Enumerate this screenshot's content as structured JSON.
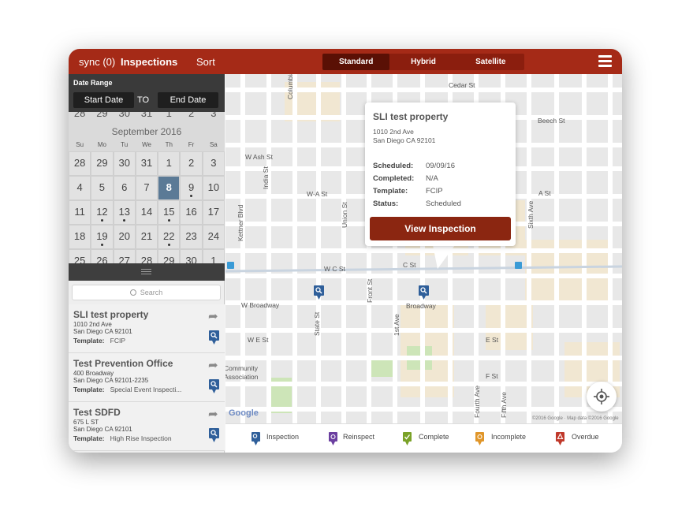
{
  "topbar": {
    "sync_label": "sync (0)",
    "inspections_label": "Inspections",
    "sort_label": "Sort",
    "map_types": [
      "Standard",
      "Hybrid",
      "Satellite"
    ],
    "active_map_type": "Standard"
  },
  "date_range": {
    "title": "Date Range",
    "start_label": "Start Date",
    "to_label": "TO",
    "end_label": "End Date"
  },
  "calendar": {
    "month_label": "September 2016",
    "prev_week_partial": [
      "28",
      "29",
      "30",
      "31",
      "1",
      "2",
      "3"
    ],
    "weekdays": [
      "Su",
      "Mo",
      "Tu",
      "We",
      "Th",
      "Fr",
      "Sa"
    ],
    "weeks": [
      [
        "28",
        "29",
        "30",
        "31",
        "1",
        "2",
        "3"
      ],
      [
        "4",
        "5",
        "6",
        "7",
        "8",
        "9",
        "10"
      ],
      [
        "11",
        "12",
        "13",
        "14",
        "15",
        "16",
        "17"
      ],
      [
        "18",
        "19",
        "20",
        "21",
        "22",
        "23",
        "24"
      ],
      [
        "25",
        "26",
        "27",
        "28",
        "29",
        "30",
        "1"
      ]
    ],
    "selected_day": "8",
    "days_with_inspections": [
      "9",
      "12",
      "13",
      "15",
      "19",
      "22"
    ]
  },
  "search": {
    "placeholder": "Search"
  },
  "properties": [
    {
      "name": "SLI test property",
      "address1": "1010  2nd Ave",
      "address2": "San Diego CA 92101",
      "template_label": "Template:",
      "template": "FCIP"
    },
    {
      "name": "Test Prevention Office",
      "address1": "400  Broadway",
      "address2": "San Diego CA 92101-2235",
      "template_label": "Template:",
      "template": "Special Event Inspecti..."
    },
    {
      "name": "Test SDFD",
      "address1": "675  L ST",
      "address2": "San Diego CA 92101",
      "template_label": "Template:",
      "template": "High Rise Inspection"
    }
  ],
  "popup": {
    "name": "SLI test property",
    "address1": "1010  2nd Ave",
    "address2": "San Diego CA 92101",
    "fields": [
      {
        "key": "Scheduled:",
        "value": "09/09/16"
      },
      {
        "key": "Completed:",
        "value": "N/A"
      },
      {
        "key": "Template:",
        "value": "FCIP"
      },
      {
        "key": "Status:",
        "value": "Scheduled"
      }
    ],
    "button_label": "View Inspection"
  },
  "map": {
    "streets": [
      "Cedar St",
      "Beech St",
      "W Ash St",
      "A St",
      "W-A St",
      "W C St",
      "C St",
      "W Broadway",
      "Broadway",
      "W E St",
      "E St",
      "F St",
      "Columbia St",
      "India St",
      "Kettner Blvd",
      "Union St",
      "Front St",
      "1st Ave",
      "State St",
      "Sixth Ave",
      "Fourth Ave",
      "Fifth Ave"
    ],
    "place_label_1": "Community",
    "place_label_2": "Association",
    "logo": "Google",
    "copyright": "©2016 Google · Map data ©2016 Google"
  },
  "legend": [
    {
      "label": "Inspection",
      "color": "#2f5f9a"
    },
    {
      "label": "Reinspect",
      "color": "#6b3fa0"
    },
    {
      "label": "Complete",
      "color": "#7aa228"
    },
    {
      "label": "Incomplete",
      "color": "#e0962a"
    },
    {
      "label": "Overdue",
      "color": "#c0392b"
    }
  ],
  "colors": {
    "brand": "#a52a17",
    "button": "#8b2611",
    "selected_day": "#5b7a96",
    "inspection_pin": "#2f5f9a"
  },
  "icons": {
    "menu": "hamburger-menu-icon",
    "search": "search-icon",
    "navigate": "share-arrow-icon",
    "locate": "my-location-icon",
    "pin": "map-pin-icon"
  }
}
